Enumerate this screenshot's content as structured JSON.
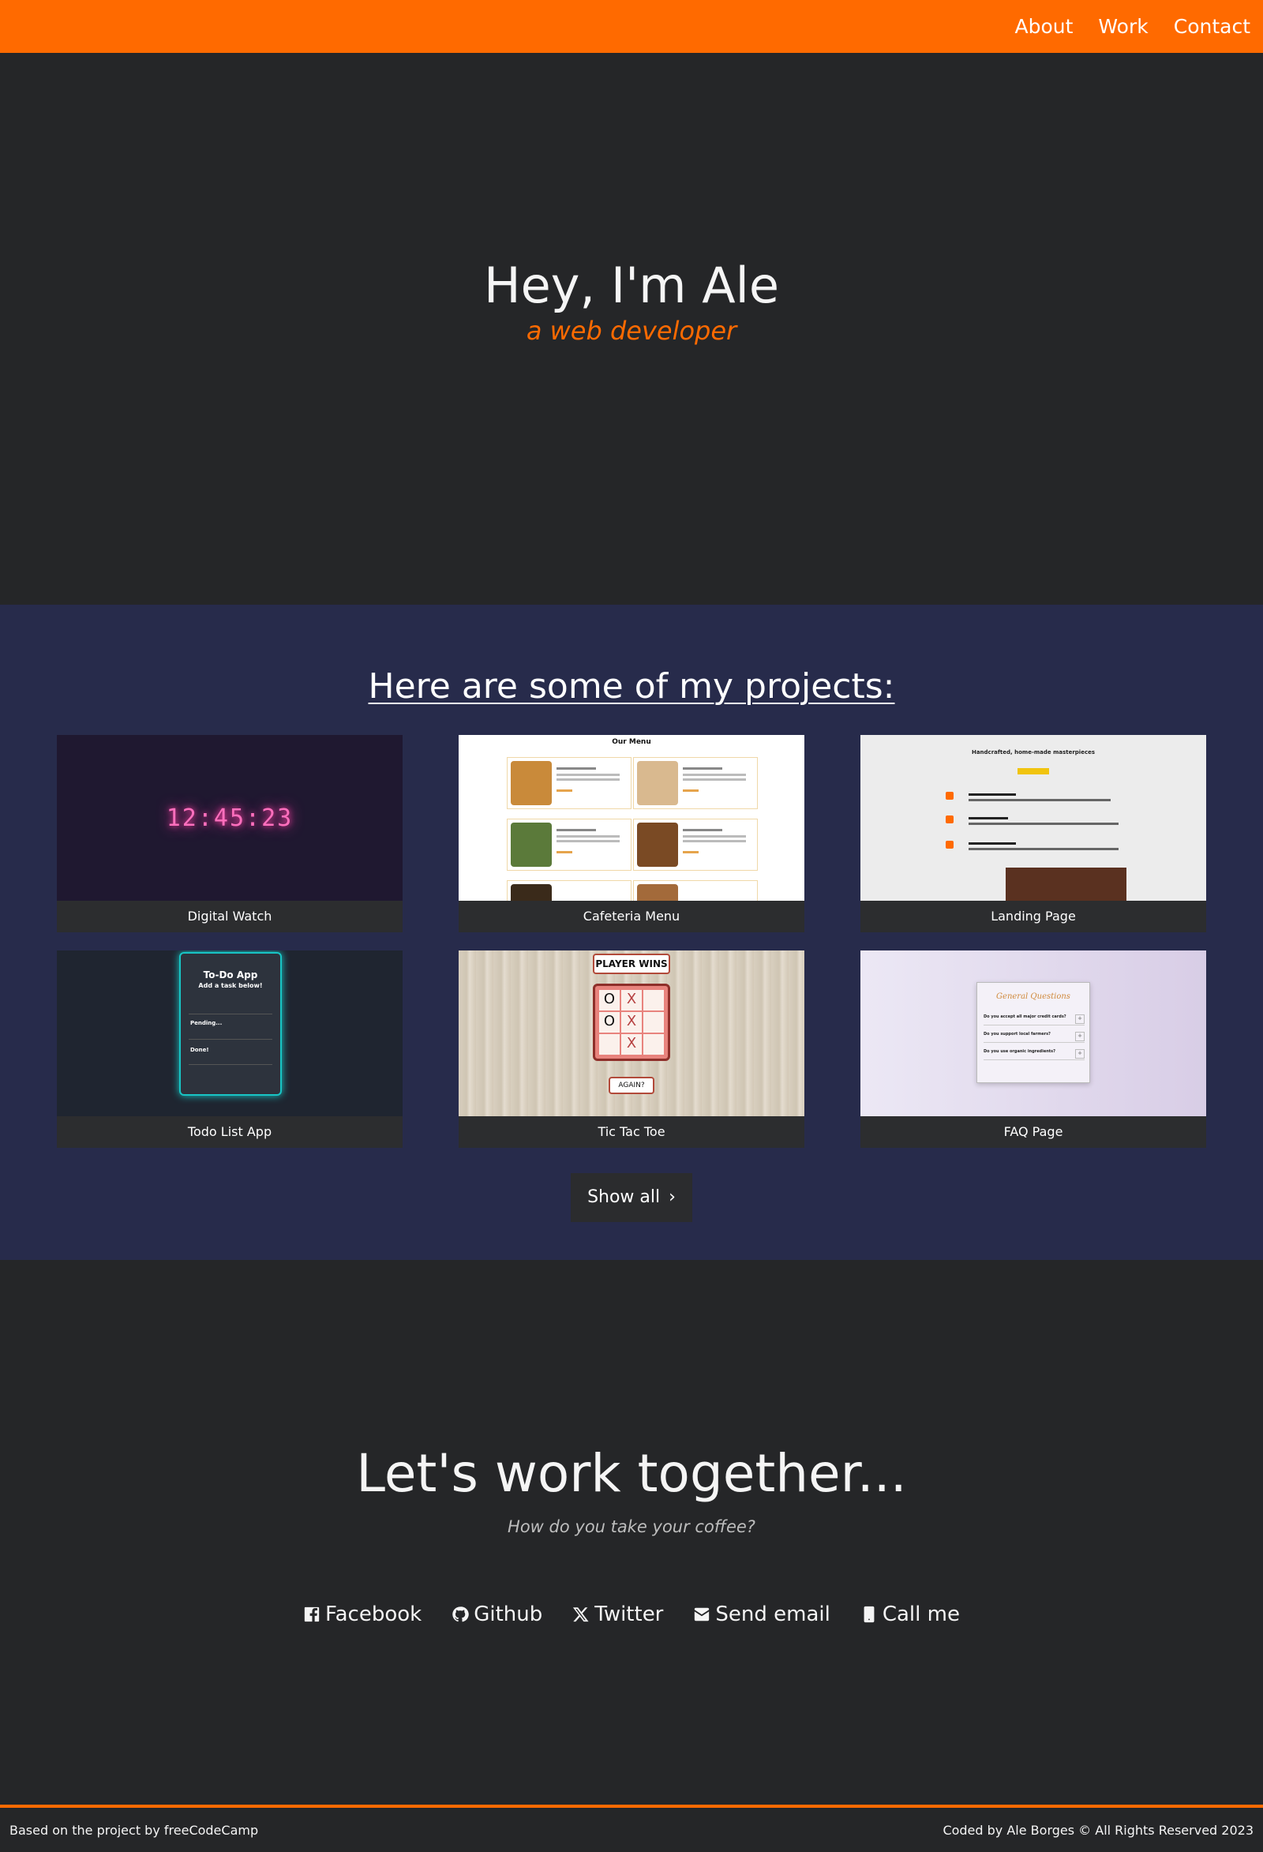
{
  "nav": {
    "links": [
      "About",
      "Work",
      "Contact"
    ]
  },
  "welcome": {
    "heading": "Hey, I'm Ale",
    "subtitle": "a web developer"
  },
  "projects": {
    "heading": "Here are some of my projects:",
    "tiles": [
      {
        "title": "Digital Watch",
        "thumb": {
          "time": "12:45:23"
        }
      },
      {
        "title": "Cafeteria Menu",
        "thumb": {
          "heading": "Our Menu"
        }
      },
      {
        "title": "Landing Page",
        "thumb": {
          "heading": "Handcrafted, home-made masterpieces"
        }
      },
      {
        "title": "Todo List App",
        "thumb": {
          "heading": "To-Do App",
          "sub": "Add a task below!",
          "pending": "Pending...",
          "done": "Done!"
        }
      },
      {
        "title": "Tic Tac Toe",
        "thumb": {
          "banner": "PLAYER WINS",
          "cells": [
            "O",
            "X",
            "",
            "O",
            "X",
            "",
            "",
            "X",
            ""
          ],
          "again": "AGAIN?"
        }
      },
      {
        "title": "FAQ Page",
        "thumb": {
          "heading": "General Questions",
          "questions": [
            "Do you accept all major credit cards?",
            "Do you support local farmers?",
            "Do you use organic ingredients?"
          ]
        }
      }
    ],
    "show_all": "Show all"
  },
  "contact": {
    "heading": "Let's work together...",
    "subtitle": "How do you take your coffee?",
    "links": [
      {
        "label": "Facebook",
        "icon": "facebook-icon"
      },
      {
        "label": "Github",
        "icon": "github-icon"
      },
      {
        "label": "Twitter",
        "icon": "twitter-x-icon"
      },
      {
        "label": "Send email",
        "icon": "envelope-icon"
      },
      {
        "label": "Call me",
        "icon": "phone-icon"
      }
    ]
  },
  "footer": {
    "left": "Based on the project by freeCodeCamp",
    "right": "Coded by Ale Borges © All Rights Reserved 2023"
  },
  "colors": {
    "accent": "#ff6a00",
    "dark_bg": "#252628",
    "projects_bg": "#272b4b"
  }
}
